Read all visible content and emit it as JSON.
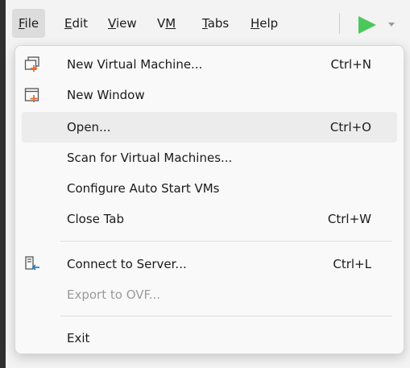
{
  "menubar": {
    "items": [
      {
        "label": "File",
        "mnemonic": "F",
        "rest": "ile"
      },
      {
        "label": "Edit",
        "mnemonic": "E",
        "rest": "dit"
      },
      {
        "label": "View",
        "mnemonic": "V",
        "rest": "iew"
      },
      {
        "label": "VM",
        "pre": "V",
        "mnemonic": "M",
        "rest": ""
      },
      {
        "label": "Tabs",
        "mnemonic": "T",
        "rest": "abs"
      },
      {
        "label": "Help",
        "mnemonic": "H",
        "rest": "elp"
      }
    ],
    "play_icon": "play-icon",
    "play_color": "#4bc85a"
  },
  "file_menu": {
    "items": [
      {
        "label": "New Virtual Machine...",
        "shortcut": "Ctrl+N",
        "icon": "new-vm-icon"
      },
      {
        "label": "New Window",
        "shortcut": "",
        "icon": "new-window-icon"
      },
      {
        "label": "Open...",
        "shortcut": "Ctrl+O"
      },
      {
        "label": "Scan for Virtual Machines...",
        "shortcut": ""
      },
      {
        "label": "Configure Auto Start VMs",
        "shortcut": ""
      },
      {
        "label": "Close Tab",
        "shortcut": "Ctrl+W"
      },
      {
        "label": "Connect to Server...",
        "shortcut": "Ctrl+L",
        "icon": "connect-server-icon"
      },
      {
        "label": "Export to OVF...",
        "shortcut": "",
        "disabled": true
      },
      {
        "label": "Exit",
        "shortcut": ""
      }
    ],
    "icon_accent": "#e8692a"
  }
}
